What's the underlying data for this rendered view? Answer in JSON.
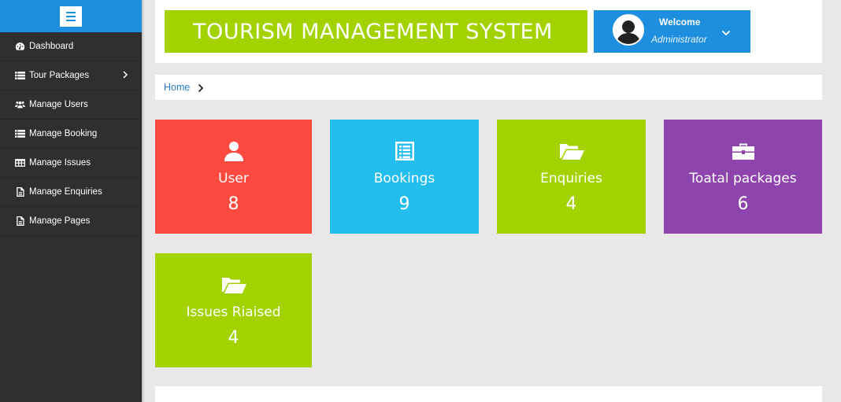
{
  "header": {
    "title": "TOURISM MANAGEMENT SYSTEM",
    "welcome": "Welcome",
    "role": "Administrator"
  },
  "sidebar": {
    "items": [
      {
        "label": "Dashboard",
        "icon": "dashboard-icon"
      },
      {
        "label": "Tour Packages",
        "icon": "list-icon"
      },
      {
        "label": "Manage Users",
        "icon": "users-icon"
      },
      {
        "label": "Manage Booking",
        "icon": "list-icon"
      },
      {
        "label": "Manage Issues",
        "icon": "table-icon"
      },
      {
        "label": "Manage Enquiries",
        "icon": "document-icon"
      },
      {
        "label": "Manage Pages",
        "icon": "document-icon"
      }
    ]
  },
  "breadcrumb": {
    "home": "Home"
  },
  "cards": [
    {
      "label": "User",
      "value": "8",
      "color": "#fd4a40",
      "icon": "user-icon"
    },
    {
      "label": "Bookings",
      "value": "9",
      "color": "#23bdee",
      "icon": "list-alt-icon"
    },
    {
      "label": "Enquiries",
      "value": "4",
      "color": "#a2d200",
      "icon": "folder-open-icon"
    },
    {
      "label": "Toatal packages",
      "value": "6",
      "color": "#8e44ad",
      "icon": "briefcase-icon"
    },
    {
      "label": "Issues Riaised",
      "value": "4",
      "color": "#a2d200",
      "icon": "folder-open-icon"
    }
  ],
  "colors": {
    "accent_blue": "#1e8fdf",
    "accent_green": "#a2d200",
    "sidebar_bg": "#2f2f2f",
    "page_bg": "#e9e7e8"
  }
}
